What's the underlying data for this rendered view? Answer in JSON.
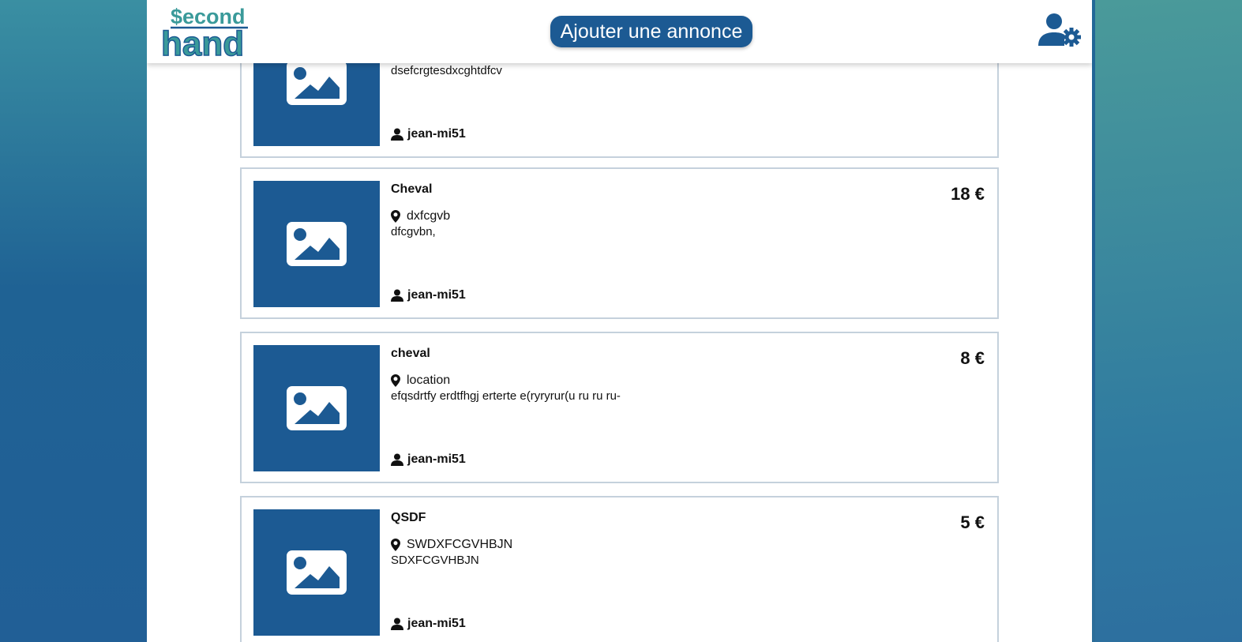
{
  "app": {
    "logo_line1": "$econd",
    "logo_line2": "hand",
    "colors": {
      "primary": "#1c5a93",
      "logo_teal": "#3a9a9a",
      "card_border": "#c5d1dc"
    }
  },
  "header": {
    "add_button_label": "Ajouter une annonce",
    "user_settings_icon": "user-gear-icon"
  },
  "listings": [
    {
      "title": "",
      "price": "",
      "location": "",
      "description": "dsefcrgtesdxcghtdfcv",
      "seller": "jean-mi51",
      "image_icon": "image-placeholder-icon"
    },
    {
      "title": "Cheval",
      "price": "18 €",
      "location": "dxfcgvb",
      "description": "dfcgvbn,",
      "seller": "jean-mi51",
      "image_icon": "image-placeholder-icon"
    },
    {
      "title": "cheval",
      "price": "8 €",
      "location": "location",
      "description": "efqsdrtfy erdtfhgj erterte e(ryryrur(u ru ru ru-",
      "seller": "jean-mi51",
      "image_icon": "image-placeholder-icon"
    },
    {
      "title": "QSDF",
      "price": "5 €",
      "location": "SWDXFCGVHBJN",
      "description": "SDXFCGVHBJN",
      "seller": "jean-mi51",
      "image_icon": "image-placeholder-icon"
    }
  ]
}
